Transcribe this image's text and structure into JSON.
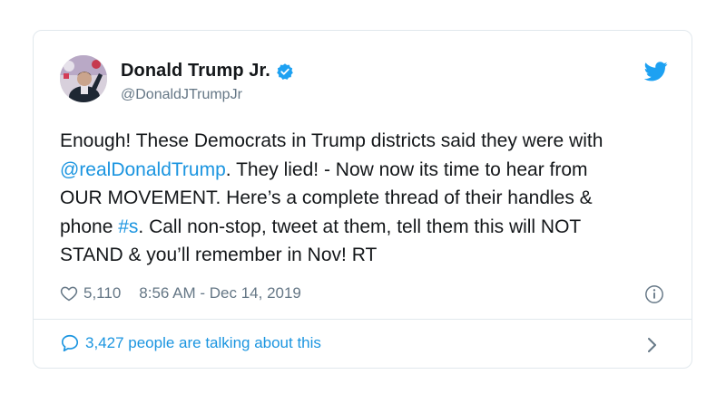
{
  "tweet": {
    "author_name": "Donald Trump Jr.",
    "handle": "@DonaldJTrumpJr",
    "lines": [
      [
        {
          "t": "Enough! These Democrats in Trump districts said they were with"
        }
      ],
      [
        {
          "t": "@realDonaldTrump",
          "link": true
        },
        {
          "t": ". They lied! - Now now its time to hear from"
        }
      ],
      [
        {
          "t": "OUR MOVEMENT. Here’s a complete thread of their handles &"
        }
      ],
      [
        {
          "t": "phone "
        },
        {
          "t": "#s",
          "link": true
        },
        {
          "t": ". Call non-stop, tweet at them, tell them this will NOT"
        }
      ],
      [
        {
          "t": "STAND & you’ll remember in Nov! RT"
        }
      ]
    ],
    "likes": "5,110",
    "timestamp": "8:56 AM - Dec 14, 2019",
    "talking": "3,427 people are talking about this"
  },
  "icons": {
    "verified": "verified-badge-icon",
    "brand": "twitter-bird-icon",
    "like": "heart-icon",
    "info": "info-icon",
    "reply": "speech-bubble-icon",
    "more": "chevron-right-icon"
  },
  "colors": {
    "link": "#1b95e0",
    "muted": "#657786",
    "text": "#14171a",
    "border": "#e1e8ed"
  }
}
